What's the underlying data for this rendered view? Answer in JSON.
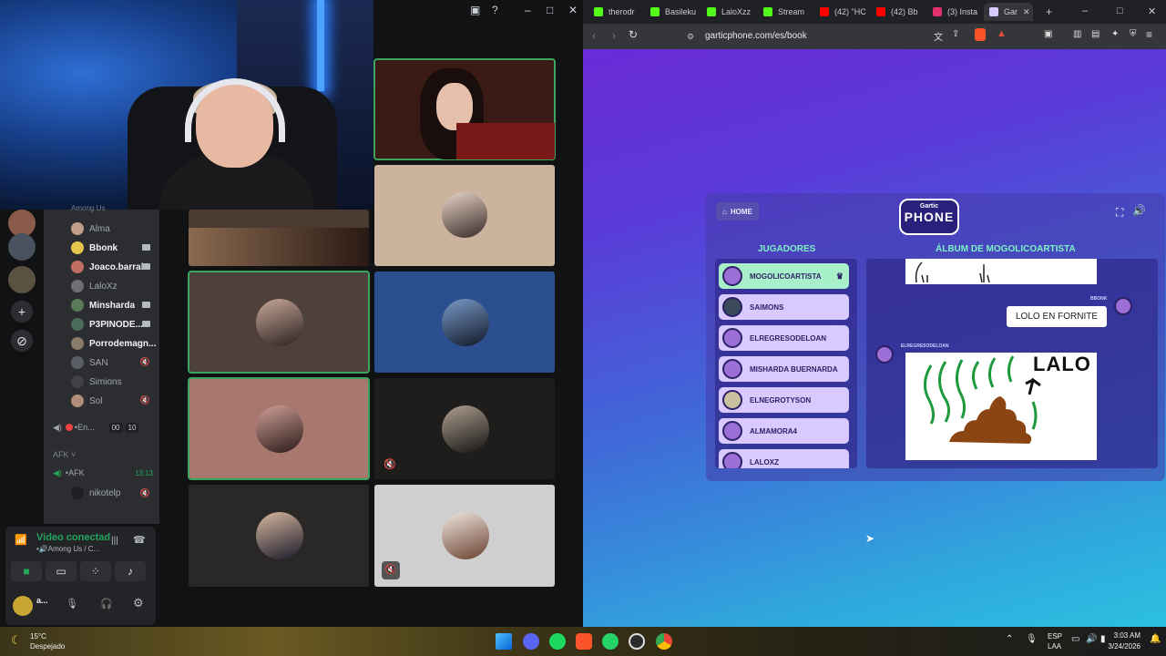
{
  "discord": {
    "channel_header": "Among Us",
    "members": [
      {
        "name": "Alma",
        "bold": false,
        "color": "#c59b8a"
      },
      {
        "name": "Bbonk",
        "bold": true,
        "color": "#e6c34a"
      },
      {
        "name": "Joaco.barral",
        "bold": true,
        "color": "#c07060"
      },
      {
        "name": "LaloXz",
        "bold": false,
        "color": "#6d6f74"
      },
      {
        "name": "Minsharda",
        "bold": true,
        "color": "#5a7a5a"
      },
      {
        "name": "P3PINODE...",
        "bold": true,
        "color": "#4a6a5a"
      },
      {
        "name": "Porrodemagn...",
        "bold": true,
        "color": "#8a7a6a"
      },
      {
        "name": "SAN",
        "bold": false,
        "color": "#5a5d63"
      },
      {
        "name": "Simions",
        "bold": false,
        "color": "#3f4147"
      },
      {
        "name": "Sol",
        "bold": false,
        "color": "#b08c7a"
      }
    ],
    "en_channel": {
      "label": "•En...",
      "count_a": "00",
      "count_b": "10"
    },
    "afk_category": "AFK",
    "afk_channel": {
      "label": "•AFK",
      "time": "13:13"
    },
    "afk_member": "nikotelp",
    "user_bar": {
      "status": "Video conectad",
      "subtitle": "•🔊Among Us / C...",
      "username": "a..."
    },
    "accent_green": "#23a55a"
  },
  "browser": {
    "tabs": [
      {
        "label": "therodr",
        "icon_color": "#53fc18"
      },
      {
        "label": "Basileku",
        "icon_color": "#53fc18"
      },
      {
        "label": "LaloXzz",
        "icon_color": "#53fc18"
      },
      {
        "label": "Stream",
        "icon_color": "#53fc18"
      },
      {
        "label": "(42) \"HC",
        "icon_color": "#ff0000"
      },
      {
        "label": "(42) Bb",
        "icon_color": "#ff0000"
      },
      {
        "label": "(3) Insta",
        "icon_color": "#e1306c"
      },
      {
        "label": "Gar",
        "icon_color": "#d8c9ff"
      }
    ],
    "url": "garticphone.com/es/book"
  },
  "gartic": {
    "home_label": "HOME",
    "logo_top": "Gartic",
    "logo_main": "PHONE",
    "players_title": "JUGADORES",
    "album_title": "ÁLBUM DE MOGOLICOARTISTA",
    "players": [
      "MOGOLICOARTISTA",
      "SAIMONS",
      "ELREGRESODELOAN",
      "MISHARDA BUERNARDA",
      "ELNEGROTYSON",
      "ALMAMORA4",
      "LALOXZ"
    ],
    "album": {
      "bubble_author": "BBONK",
      "bubble_text": "LOLO EN FORNITE",
      "drawing_author": "ELREGRESODELOAN",
      "drawing_text": "LALO"
    }
  },
  "taskbar": {
    "weather_temp": "15°C",
    "weather_desc": "Despejado",
    "lang_top": "ESP",
    "lang_bottom": "LAA",
    "time": "3:03 AM",
    "date": "3/24/2026"
  }
}
